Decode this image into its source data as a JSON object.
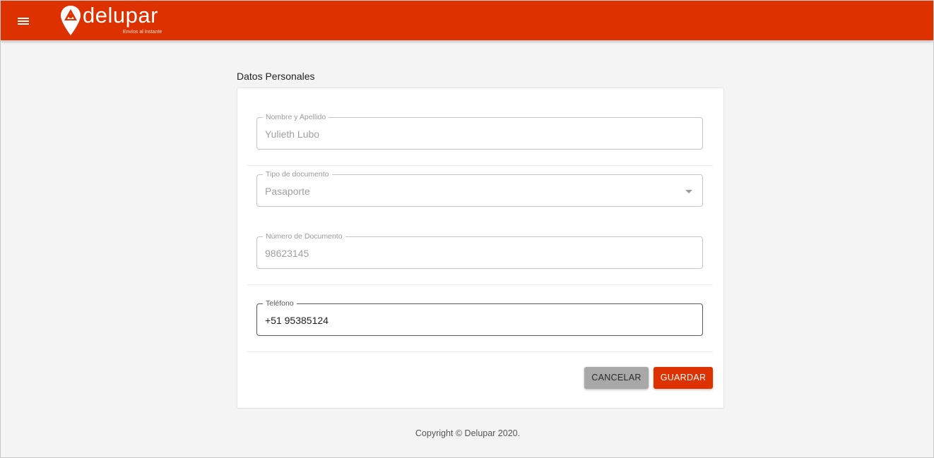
{
  "header": {
    "brand_name": "delupar",
    "brand_tagline": "Envíos al instante",
    "brand_color": "#dd3100",
    "menu_icon": "hamburger-menu-icon"
  },
  "form": {
    "section_title": "Datos Personales",
    "fields": [
      {
        "label": "Nombre y Apellido",
        "value": "Yulieth Lubo",
        "editable": false
      },
      {
        "label": "Tipo de documento",
        "value": "Pasaporte",
        "type": "select",
        "editable": false
      },
      {
        "label": "Número de Documento",
        "value": "98623145",
        "editable": false
      },
      {
        "label": "Teléfono",
        "value": "+51 95385124",
        "editable": true
      }
    ],
    "buttons": {
      "cancel_label": "CANCELAR",
      "save_label": "GUARDAR"
    }
  },
  "footer": {
    "copyright": "Copyright © Delupar 2020."
  }
}
